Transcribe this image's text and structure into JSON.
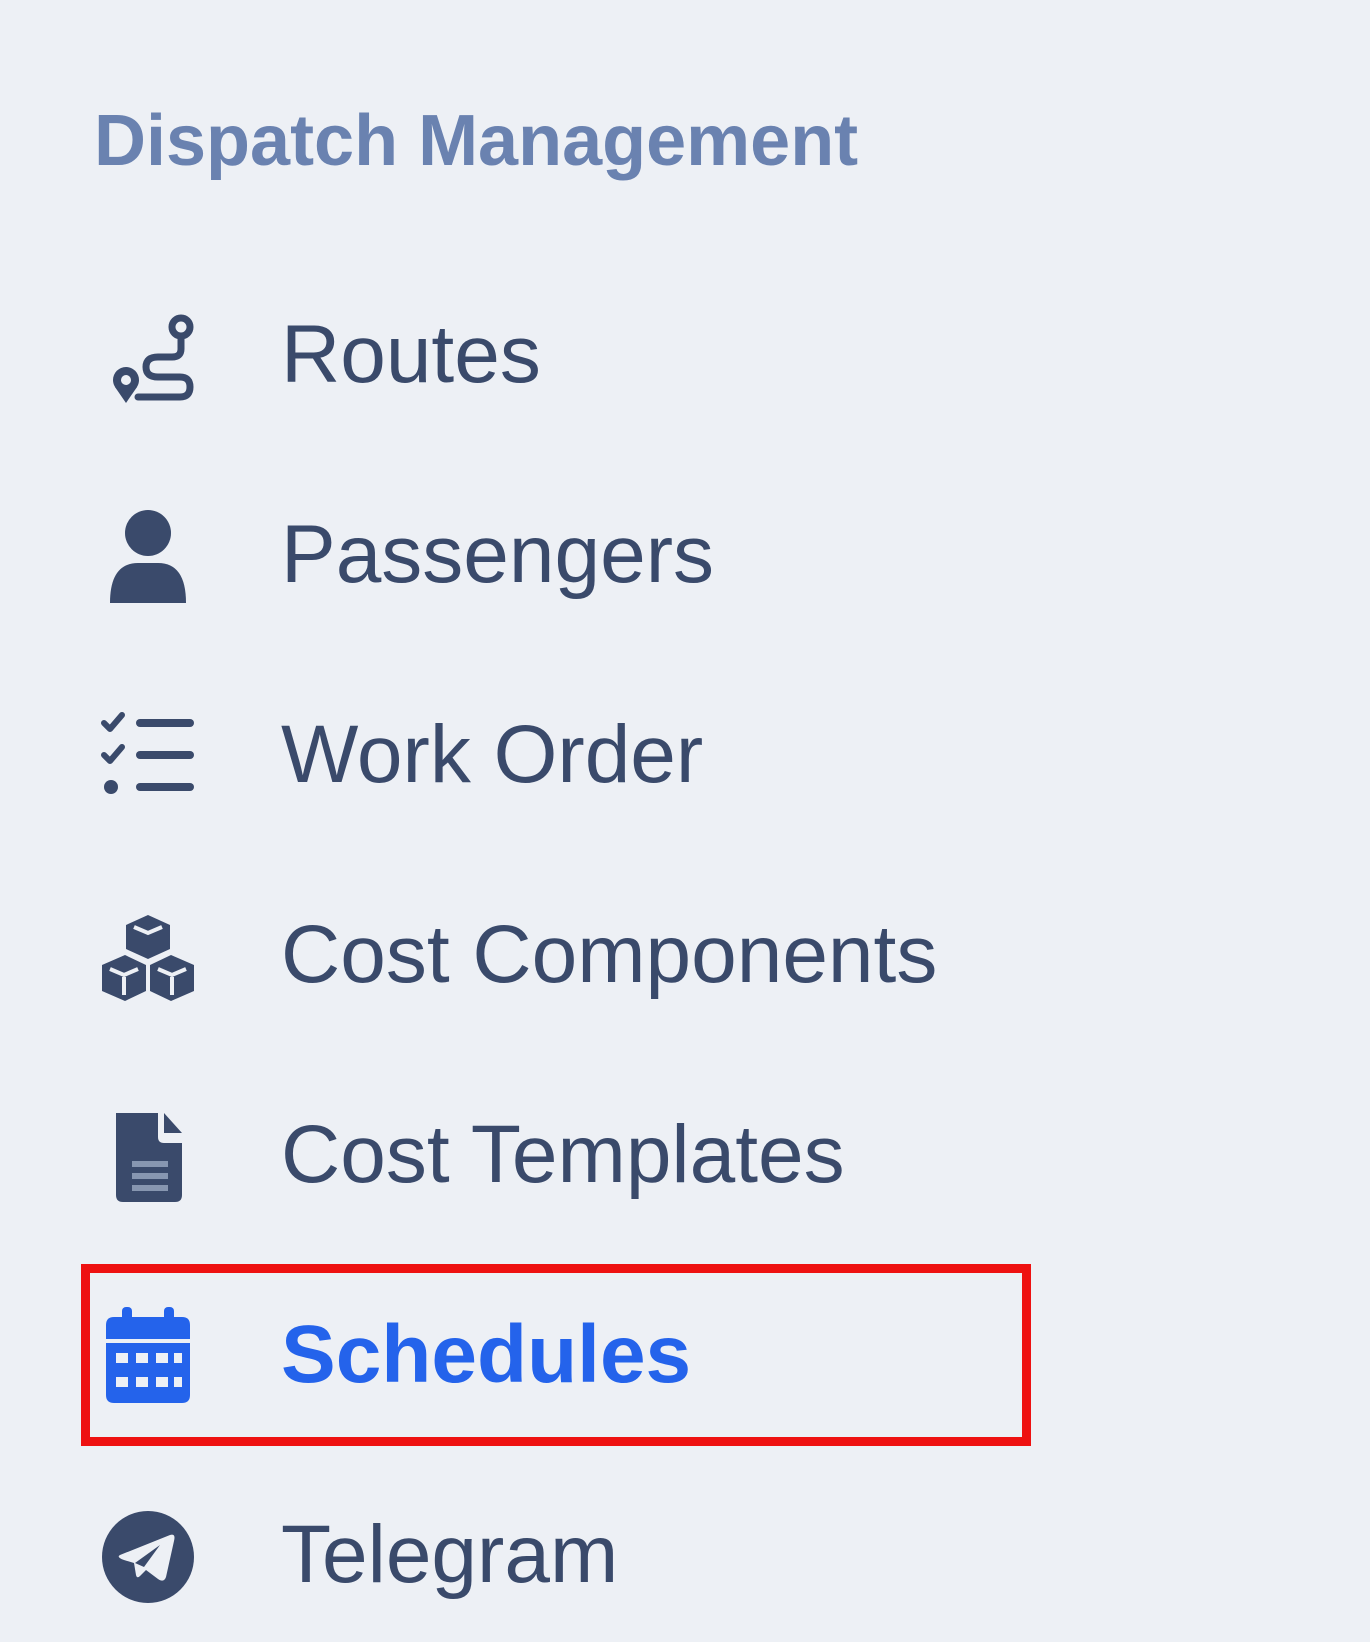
{
  "sidebar": {
    "section_title": "Dispatch Management",
    "items": [
      {
        "label": "Routes",
        "icon": "route-icon",
        "active": false
      },
      {
        "label": "Passengers",
        "icon": "user-icon",
        "active": false
      },
      {
        "label": "Work Order",
        "icon": "list-check-icon",
        "active": false
      },
      {
        "label": "Cost Components",
        "icon": "cubes-icon",
        "active": false
      },
      {
        "label": "Cost Templates",
        "icon": "file-lines-icon",
        "active": false
      },
      {
        "label": "Schedules",
        "icon": "calendar-days-icon",
        "active": true
      },
      {
        "label": "Telegram",
        "icon": "telegram-icon",
        "active": false
      }
    ]
  },
  "colors": {
    "background": "#edf0f5",
    "section_title": "#6a82b0",
    "item_text": "#3a4a6b",
    "active": "#2463eb",
    "highlight_border": "#ee1111"
  }
}
